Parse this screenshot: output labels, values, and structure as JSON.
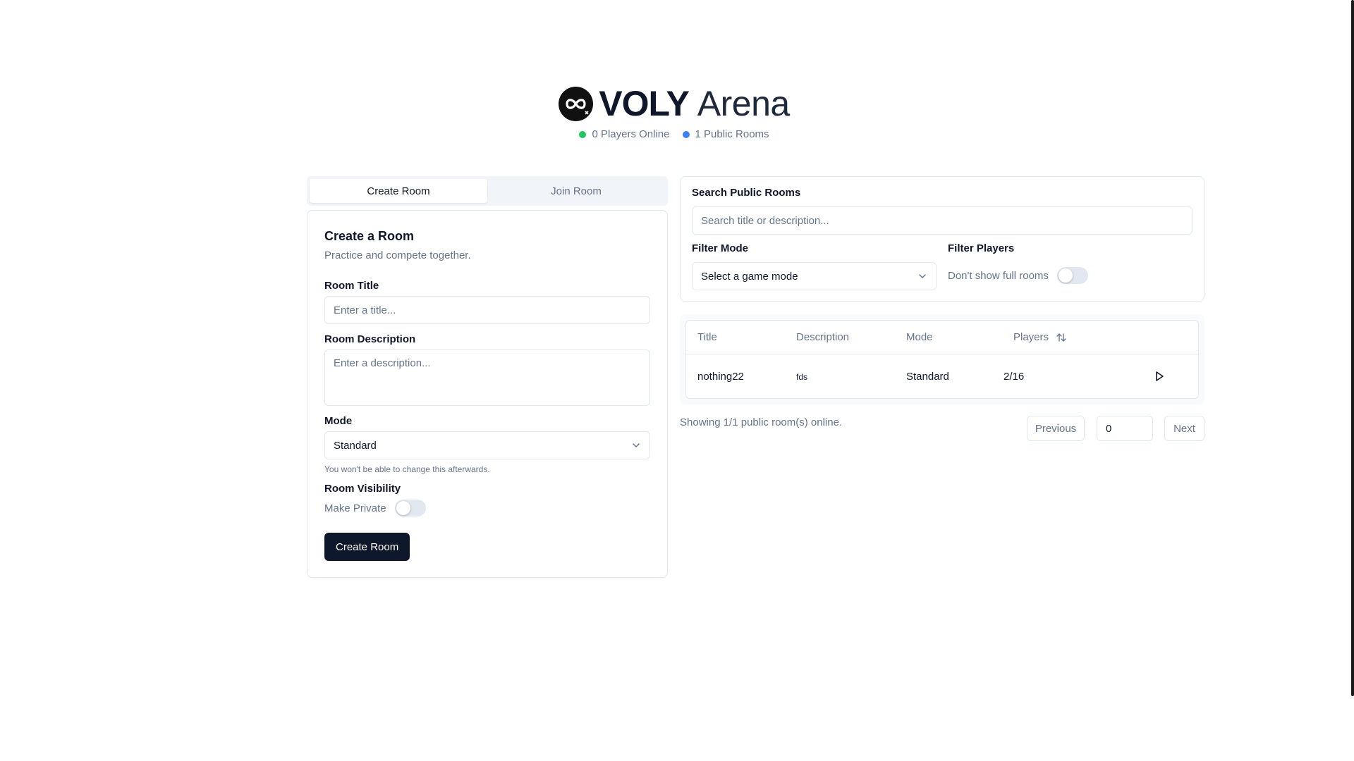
{
  "brand": {
    "name_bold": "VOLY",
    "name_light": "Arena",
    "logo_icon": "infinity-logo-icon"
  },
  "stats": {
    "players_online": "0 Players Online",
    "public_rooms": "1 Public Rooms",
    "players_color": "#22c55e",
    "rooms_color": "#3b82f6"
  },
  "tabs": [
    {
      "label": "Create Room",
      "active": true
    },
    {
      "label": "Join Room",
      "active": false
    }
  ],
  "create_form": {
    "title": "Create a Room",
    "subtitle": "Practice and compete together.",
    "room_title_label": "Room Title",
    "room_title_placeholder": "Enter a title...",
    "room_title_value": "",
    "description_label": "Room Description",
    "description_placeholder": "Enter a description...",
    "description_value": "",
    "mode_label": "Mode",
    "mode_value": "Standard",
    "mode_hint": "You won't be able to change this afterwards.",
    "visibility_label": "Room Visibility",
    "private_label": "Make Private",
    "private_enabled": false,
    "submit_label": "Create Room"
  },
  "search": {
    "label": "Search Public Rooms",
    "placeholder": "Search title or description...",
    "value": "",
    "filter_mode_label": "Filter Mode",
    "filter_mode_placeholder": "Select a game mode",
    "filter_players_label": "Filter Players",
    "hide_full_label": "Don't show full rooms",
    "hide_full_enabled": false
  },
  "table": {
    "columns": [
      "Title",
      "Description",
      "Mode",
      "Players"
    ],
    "rows": [
      {
        "title": "nothing22",
        "description": "fds",
        "mode": "Standard",
        "players": "2/16"
      }
    ]
  },
  "pagination": {
    "summary": "Showing 1/1 public room(s) online.",
    "previous_label": "Previous",
    "page_value": "0",
    "next_label": "Next"
  },
  "colors": {
    "primary": "#0f172a",
    "border": "#e2e8f0",
    "muted": "#64748b"
  }
}
